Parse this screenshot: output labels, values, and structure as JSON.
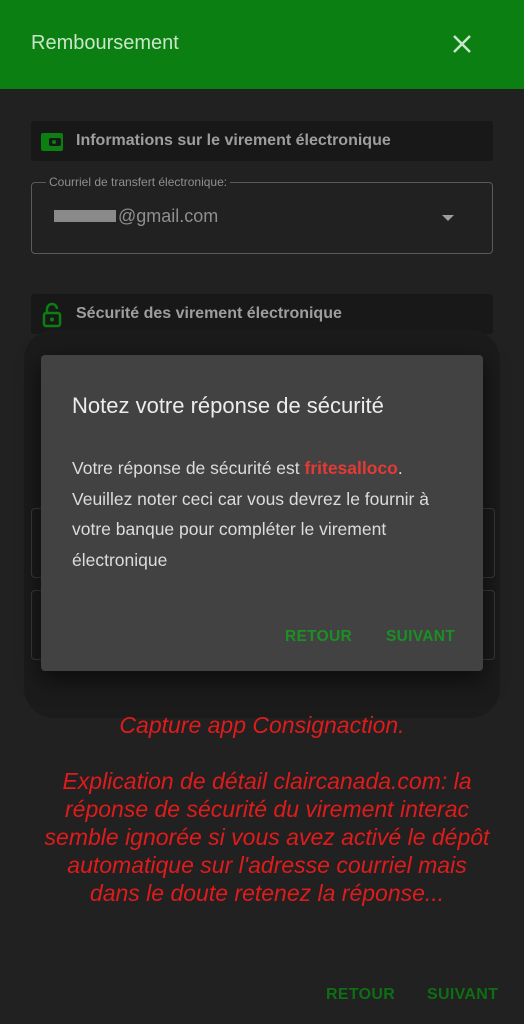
{
  "appbar": {
    "title": "Remboursement"
  },
  "transfer_section": {
    "header": "Informations sur le virement électronique",
    "email_label": "Courriel de transfert électronique:",
    "email_value": "@gmail.com"
  },
  "security_section": {
    "header": "Sécurité des virement électronique"
  },
  "dialog": {
    "title": "Notez votre réponse de sécurité",
    "body_prefix": "Votre réponse de sécurité est ",
    "answer": "fritesalloco",
    "body_suffix": ". Veuillez noter ceci car vous devrez le fournir à votre banque pour compléter le virement électronique",
    "back_label": "RETOUR",
    "next_label": "SUIVANT"
  },
  "annotation": {
    "caption": "Capture app Consignaction.",
    "explanation": "Explication de détail claircanada.com: la réponse de sécurité du virement interac semble ignorée si vous avez activé le dépôt automatique sur l'adresse courriel mais dans le doute retenez la réponse..."
  },
  "footer": {
    "back_label": "RETOUR",
    "next_label": "SUIVANT"
  },
  "colors": {
    "appbar": "#0b7f11",
    "accent": "#1b8f24",
    "answer": "#e53935",
    "annotation": "#e01b1b"
  }
}
